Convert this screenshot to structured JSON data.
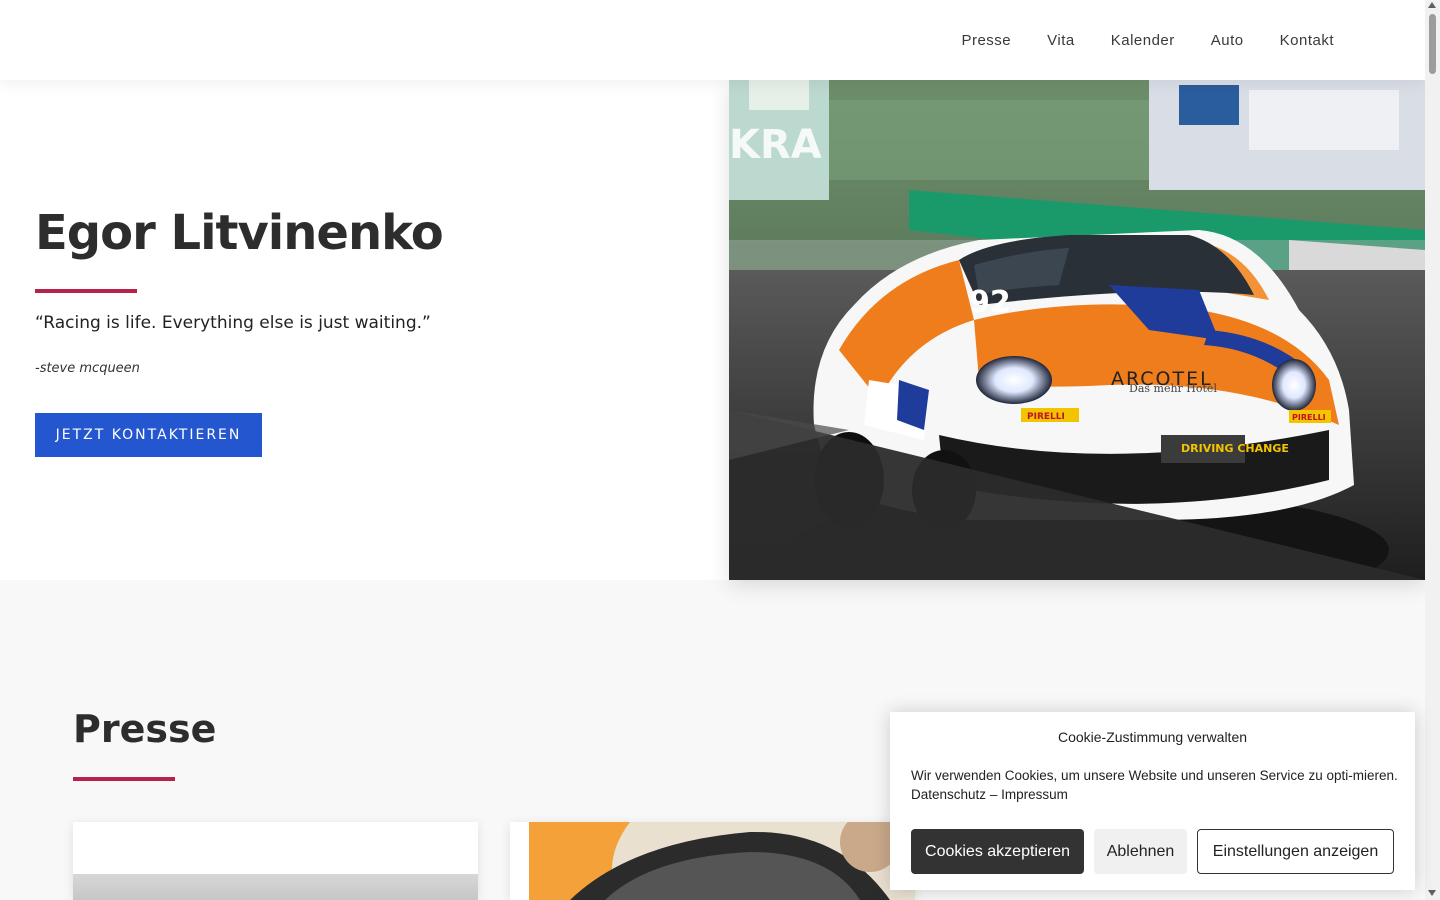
{
  "nav": {
    "items": [
      {
        "label": "Presse"
      },
      {
        "label": "Vita"
      },
      {
        "label": "Kalender"
      },
      {
        "label": "Auto"
      },
      {
        "label": "Kontakt"
      }
    ]
  },
  "hero": {
    "title": "Egor Litvinenko",
    "quote": "“Racing is life. Everything else is just waiting.”",
    "author": "-steve mcqueen",
    "cta_label": "JETZT KONTAKTIEREN",
    "car_number": "92",
    "car_sponsor": "ARCOTEL",
    "car_sponsor_tagline": "Das mehr Hotel",
    "tire_brand": "PIRELLI",
    "sticker": "DRIVING CHANGE",
    "lettering": "KRA"
  },
  "presse": {
    "title": "Presse"
  },
  "cookie": {
    "title": "Cookie-Zustimmung verwalten",
    "text": "Wir verwenden Cookies, um unsere Website und unseren Service zu opti-mieren.",
    "link_privacy": "Datenschutz",
    "separator": "–",
    "link_imprint": "Impressum",
    "accept_label": "Cookies akzeptieren",
    "deny_label": "Ablehnen",
    "settings_label": "Einstellungen anzeigen"
  },
  "colors": {
    "accent_line": "#b5234a",
    "cta_bg": "#2356cf",
    "cookie_accept_bg": "#333333",
    "car_orange": "#ef7d1c"
  }
}
